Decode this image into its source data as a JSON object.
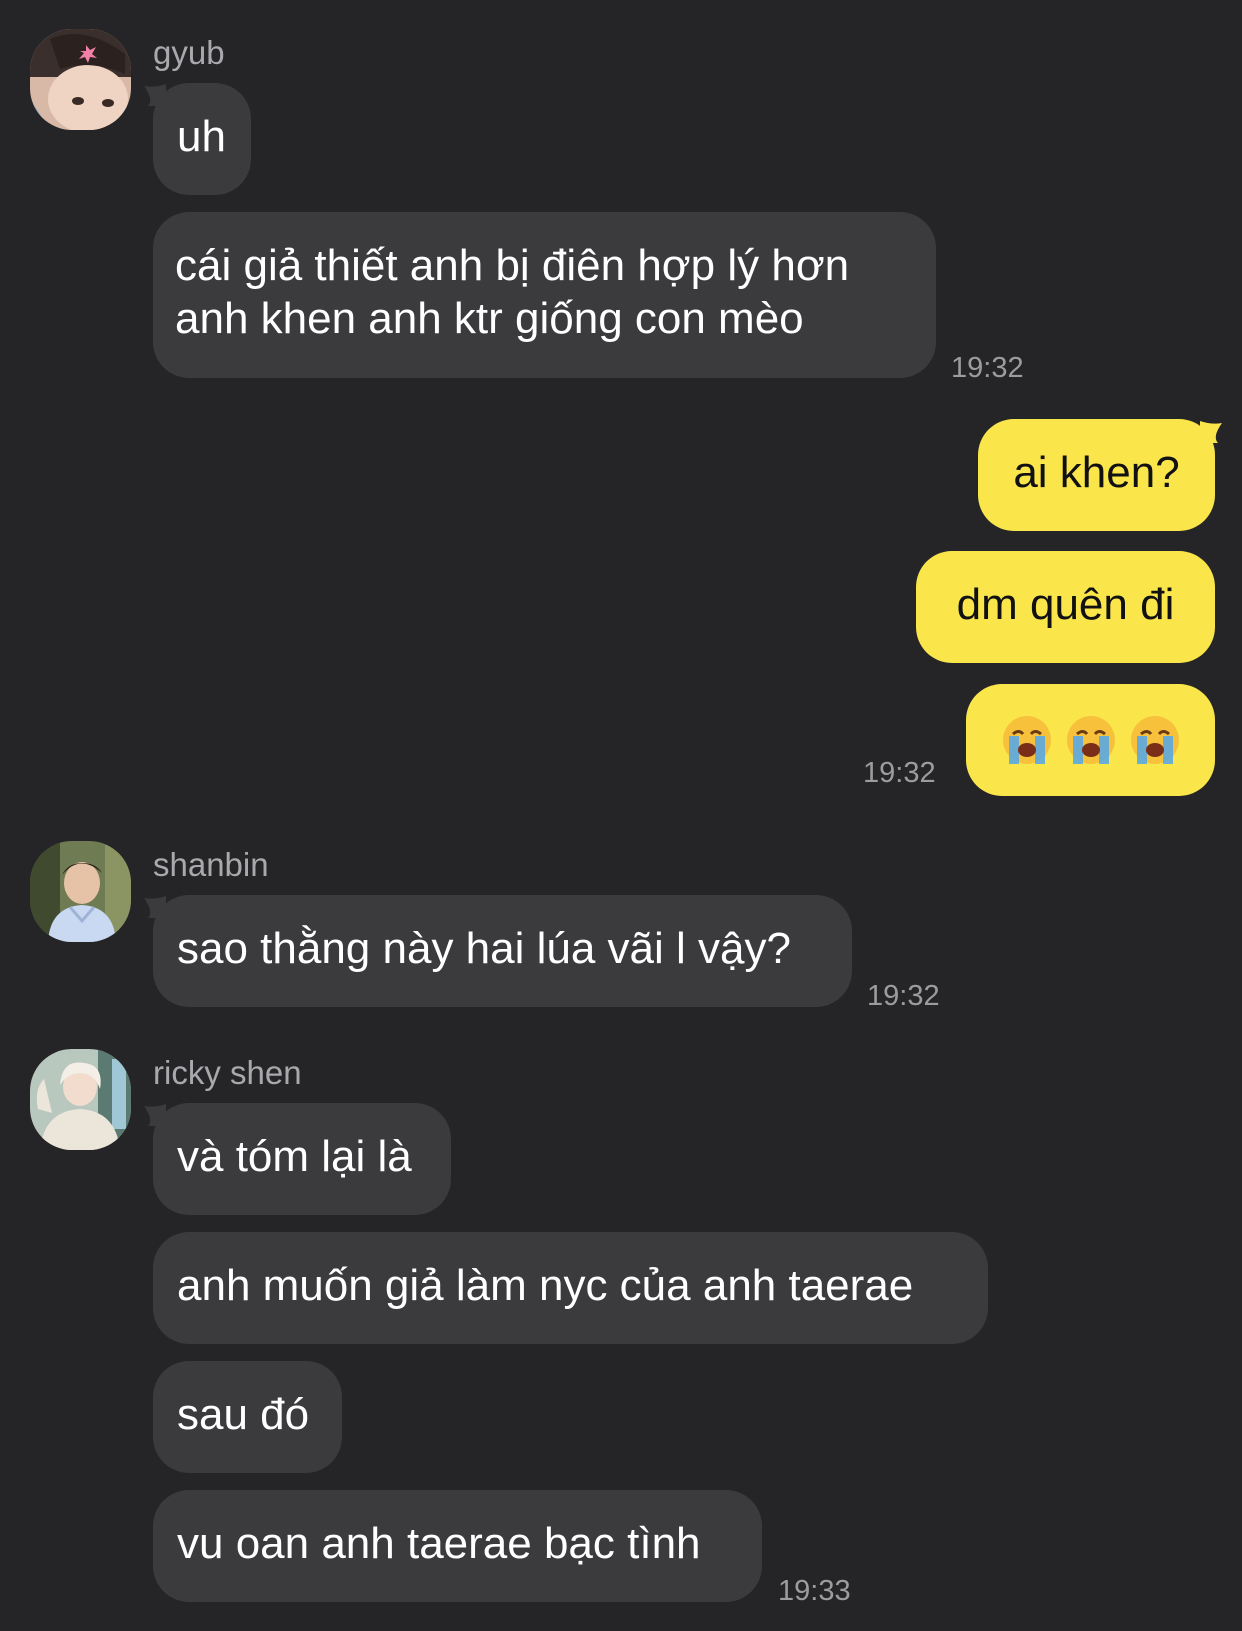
{
  "groups": [
    {
      "sender": "gyub",
      "avatar_icon": "avatar-gyub",
      "messages": [
        "uh",
        "cái giả thiết anh bị điên hợp lý hơn anh khen anh ktr giống con mèo"
      ],
      "time": "19:32"
    },
    {
      "sender": "me",
      "messages": [
        "ai khen?",
        "dm quên đi"
      ],
      "emoji": [
        "loudly-crying-face-icon",
        "loudly-crying-face-icon",
        "loudly-crying-face-icon"
      ],
      "time": "19:32"
    },
    {
      "sender": "shanbin",
      "avatar_icon": "avatar-shanbin",
      "messages": [
        "sao thằng này hai lúa vãi l vậy?"
      ],
      "time": "19:32"
    },
    {
      "sender": "ricky shen",
      "avatar_icon": "avatar-ricky-shen",
      "messages": [
        "và tóm lại là",
        "anh muốn giả làm nyc của anh taerae",
        "sau đó",
        "vu oan anh taerae bạc tình"
      ],
      "time": "19:33"
    }
  ],
  "colors": {
    "background": "#252527",
    "incoming_bubble": "#3b3b3e",
    "outgoing_bubble": "#fae64b",
    "name_text": "#a9a9ad",
    "time_text": "#9c9ca0"
  }
}
